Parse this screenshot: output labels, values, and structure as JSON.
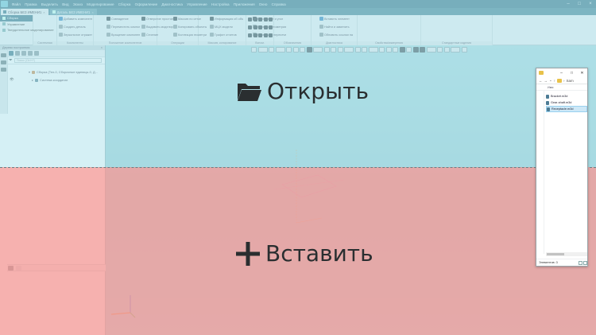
{
  "menubar": {
    "items": [
      "Файл",
      "Правка",
      "Выделить",
      "Вид",
      "Эскиз",
      "Моделирование",
      "Сборка",
      "Оформление",
      "Диагностика",
      "Управление",
      "Настройка",
      "Приложения",
      "Окно",
      "Справка"
    ]
  },
  "doc_tabs": [
    {
      "label": "Сборка БЕЗ ИМЕНИ1",
      "active": true
    },
    {
      "label": "Деталь БЕЗ ИМЕНИ1",
      "active": false
    }
  ],
  "ribbon": {
    "left_panel": [
      "Сборка",
      "Управление",
      "Твердотельное моделирование"
    ],
    "buttons": [
      {
        "label": "Добавить компонент из...",
        "icon": "blue"
      },
      {
        "label": "Создать деталь",
        "icon": "grey"
      },
      {
        "label": "Зеркальное отражение к...",
        "icon": "grey"
      },
      {
        "label": "Совпадение",
        "icon": "dark"
      },
      {
        "label": "Переместить компонент",
        "icon": "grey"
      },
      {
        "label": "Вращение компонента",
        "icon": "grey"
      },
      {
        "label": "Отверстие простое",
        "icon": "dark"
      },
      {
        "label": "Выдавить моделирование",
        "icon": "grey"
      },
      {
        "label": "Сечение",
        "icon": "grey"
      },
      {
        "label": "Массив по сетке",
        "icon": "dark"
      },
      {
        "label": "Копировать объекты",
        "icon": "grey"
      },
      {
        "label": "Коллекция геометрии",
        "icon": "grey"
      },
      {
        "label": "Информация об объекте",
        "icon": "dark"
      },
      {
        "label": "МЦХ модели",
        "icon": "grey"
      },
      {
        "label": "Графит отчетов",
        "icon": "grey"
      },
      {
        "label": "Расстояние и угол",
        "icon": "dark"
      },
      {
        "label": "Проверка геометрии",
        "icon": "grey"
      },
      {
        "label": "Проверить пересечения",
        "icon": "grey"
      },
      {
        "label": "Вставить элемент",
        "icon": "blue"
      },
      {
        "label": "Найти и заменить",
        "icon": "grey"
      },
      {
        "label": "Обновить ссылки на изо...",
        "icon": "grey"
      }
    ],
    "groups": [
      "Системная",
      "Компоненты",
      "Положение компонентов",
      "Операции",
      "Массив, копирование",
      "Вспом.",
      "Обозначения",
      "Диагностика",
      "Свойства/измерения",
      "Стандартные изделия"
    ]
  },
  "tree": {
    "header": "Дерево построения",
    "filter_placeholder": "Поиск (Ctrl+F)",
    "rows": [
      {
        "label": "Сборка (Тел-0, Сборочные единицы-0, Д...",
        "toggle": "▾",
        "icon": "part"
      },
      {
        "label": "Система координат",
        "toggle": "▸",
        "icon": "axes"
      }
    ]
  },
  "overlay": {
    "open_label": "Открыть",
    "insert_label": "Вставить"
  },
  "explorer": {
    "address": "Sam",
    "column_header": "Имя",
    "files": [
      {
        "name": "Bracket.m3d",
        "selected": false
      },
      {
        "name": "Gear-shaft.m3d",
        "selected": false
      },
      {
        "name": "Receptacle.m3d",
        "selected": true
      }
    ],
    "status": "Элементов: 3"
  },
  "colors": {
    "accent": "#2f6e80",
    "open_zone": "#b2e4ec",
    "insert_zone": "#f4a09e"
  }
}
